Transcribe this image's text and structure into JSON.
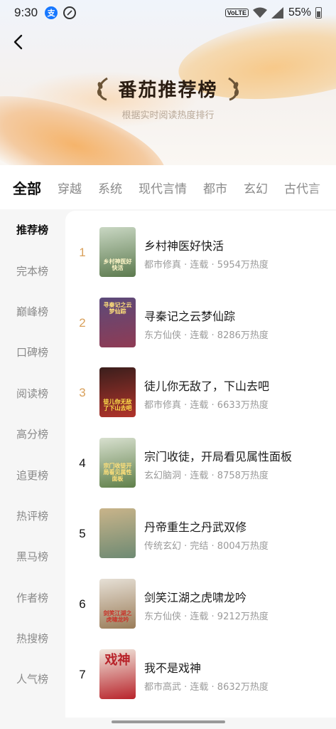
{
  "status_bar": {
    "time": "9:30",
    "alipay_glyph": "支",
    "volte": "VoLTE",
    "battery": "55%"
  },
  "header": {
    "back_icon": "back-arrow-icon",
    "title": "番茄推荐榜",
    "subtitle": "根据实时阅读热度排行"
  },
  "tabs": [
    {
      "label": "全部",
      "active": true
    },
    {
      "label": "穿越"
    },
    {
      "label": "系统"
    },
    {
      "label": "现代言情"
    },
    {
      "label": "都市"
    },
    {
      "label": "玄幻"
    },
    {
      "label": "古代言"
    }
  ],
  "sidebar": {
    "items": [
      {
        "label": "推荐榜",
        "active": true
      },
      {
        "label": "完本榜"
      },
      {
        "label": "巅峰榜"
      },
      {
        "label": "口碑榜"
      },
      {
        "label": "阅读榜"
      },
      {
        "label": "高分榜"
      },
      {
        "label": "追更榜"
      },
      {
        "label": "热评榜"
      },
      {
        "label": "黑马榜"
      },
      {
        "label": "作者榜"
      },
      {
        "label": "热搜榜"
      },
      {
        "label": "人气榜"
      }
    ]
  },
  "books": [
    {
      "rank": "1",
      "title": "乡村神医好快活",
      "meta": "都市修真 · 连载 · 5954万热度",
      "cover_text": "乡村神医好快活",
      "cover_colors": [
        "#c9d7c3",
        "#5c7a4e"
      ]
    },
    {
      "rank": "2",
      "title": "寻秦记之云梦仙踪",
      "meta": "东方仙侠 · 连载 · 8286万热度",
      "cover_text": "寻秦记之云梦仙踪",
      "cover_colors": [
        "#5b4a7a",
        "#8f3b54"
      ]
    },
    {
      "rank": "3",
      "title": "徒儿你无敌了，下山去吧",
      "meta": "都市修真 · 连载 · 6633万热度",
      "cover_text": "徒儿你无敌了下山去吧",
      "cover_colors": [
        "#3a1e1c",
        "#b2342b"
      ]
    },
    {
      "rank": "4",
      "title": "宗门收徒，开局看见属性面板",
      "meta": "玄幻脑洞 · 连载 · 8758万热度",
      "cover_text": "宗门收徒开局看见属性面板",
      "cover_colors": [
        "#d8e0cf",
        "#5f7f49"
      ]
    },
    {
      "rank": "5",
      "title": "丹帝重生之丹武双修",
      "meta": "传统玄幻 · 完结 · 8004万热度",
      "cover_text": "",
      "cover_colors": [
        "#c9b48a",
        "#6e8a73"
      ]
    },
    {
      "rank": "6",
      "title": "剑笑江湖之虎啸龙吟",
      "meta": "东方仙侠 · 连载 · 9212万热度",
      "cover_text": "剑笑江湖之虎啸龙吟",
      "cover_colors": [
        "#e6e0d6",
        "#9a7c58"
      ]
    },
    {
      "rank": "7",
      "title": "我不是戏神",
      "meta": "都市高武 · 连载 · 8632万热度",
      "cover_text": "戏神",
      "cover_colors": [
        "#f1e8de",
        "#b8232a"
      ]
    }
  ]
}
